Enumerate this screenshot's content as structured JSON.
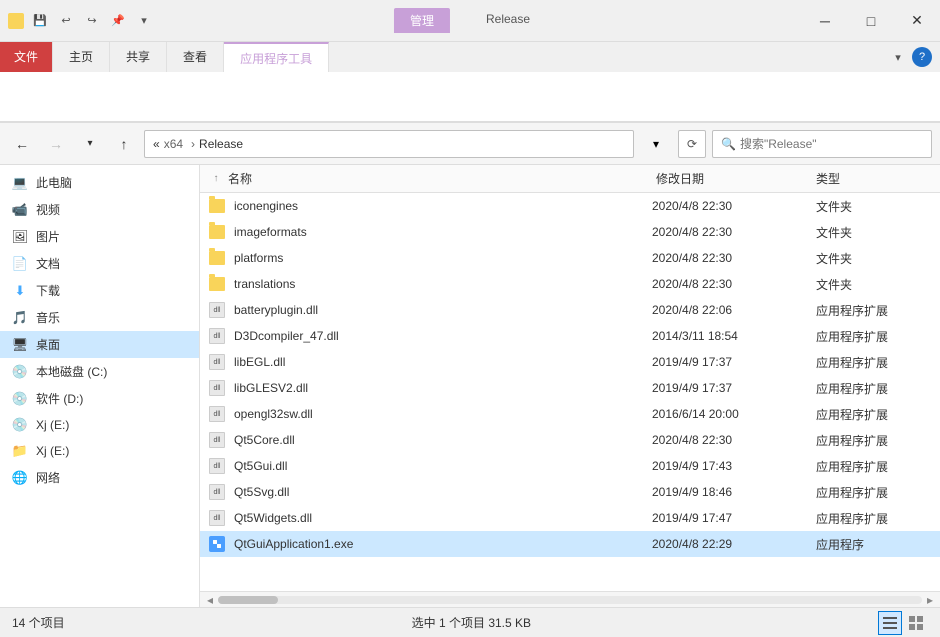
{
  "titleBar": {
    "appIcon": "folder",
    "tabManage": "管理",
    "tabName": "Release",
    "minimize": "─",
    "maximize": "□",
    "close": "✕"
  },
  "ribbon": {
    "tabs": [
      {
        "id": "file",
        "label": "文件",
        "active": false
      },
      {
        "id": "home",
        "label": "主页",
        "active": false
      },
      {
        "id": "share",
        "label": "共享",
        "active": false
      },
      {
        "id": "view",
        "label": "查看",
        "active": false
      },
      {
        "id": "apptools",
        "label": "应用程序工具",
        "active": true
      }
    ]
  },
  "addressBar": {
    "backDisabled": false,
    "forwardDisabled": true,
    "upLabel": "↑",
    "breadcrumb": [
      "«",
      "x64",
      "Release"
    ],
    "refreshLabel": "⟳",
    "searchPlaceholder": "搜索\"Release\""
  },
  "sidebar": {
    "items": [
      {
        "id": "this-pc",
        "label": "此电脑",
        "icon": "computer"
      },
      {
        "id": "video",
        "label": "视频",
        "icon": "folder-video"
      },
      {
        "id": "pictures",
        "label": "图片",
        "icon": "folder-pic"
      },
      {
        "id": "documents",
        "label": "文档",
        "icon": "folder-doc"
      },
      {
        "id": "downloads",
        "label": "下载",
        "icon": "download"
      },
      {
        "id": "music",
        "label": "音乐",
        "icon": "folder-music"
      },
      {
        "id": "desktop",
        "label": "桌面",
        "icon": "desktop",
        "selected": true
      },
      {
        "id": "local-c",
        "label": "本地磁盘 (C:)",
        "icon": "drive-c"
      },
      {
        "id": "drive-d",
        "label": "软件 (D:)",
        "icon": "drive-d"
      },
      {
        "id": "drive-xj-e",
        "label": "Xj (E:)",
        "icon": "drive-e"
      },
      {
        "id": "xj-e2",
        "label": "Xj (E:)",
        "icon": "drive-e2"
      },
      {
        "id": "network",
        "label": "网络",
        "icon": "network"
      }
    ]
  },
  "fileList": {
    "columns": {
      "name": "名称",
      "date": "修改日期",
      "type": "类型"
    },
    "files": [
      {
        "name": "iconengines",
        "date": "2020/4/8 22:30",
        "type": "文件夹",
        "kind": "folder"
      },
      {
        "name": "imageformats",
        "date": "2020/4/8 22:30",
        "type": "文件夹",
        "kind": "folder"
      },
      {
        "name": "platforms",
        "date": "2020/4/8 22:30",
        "type": "文件夹",
        "kind": "folder"
      },
      {
        "name": "translations",
        "date": "2020/4/8 22:30",
        "type": "文件夹",
        "kind": "folder"
      },
      {
        "name": "batteryplugin.dll",
        "date": "2020/4/8 22:06",
        "type": "应用程序扩展",
        "kind": "dll"
      },
      {
        "name": "D3Dcompiler_47.dll",
        "date": "2014/3/11 18:54",
        "type": "应用程序扩展",
        "kind": "dll"
      },
      {
        "name": "libEGL.dll",
        "date": "2019/4/9 17:37",
        "type": "应用程序扩展",
        "kind": "dll"
      },
      {
        "name": "libGLESV2.dll",
        "date": "2019/4/9 17:37",
        "type": "应用程序扩展",
        "kind": "dll"
      },
      {
        "name": "opengl32sw.dll",
        "date": "2016/6/14 20:00",
        "type": "应用程序扩展",
        "kind": "dll"
      },
      {
        "name": "Qt5Core.dll",
        "date": "2020/4/8 22:30",
        "type": "应用程序扩展",
        "kind": "dll"
      },
      {
        "name": "Qt5Gui.dll",
        "date": "2019/4/9 17:43",
        "type": "应用程序扩展",
        "kind": "dll"
      },
      {
        "name": "Qt5Svg.dll",
        "date": "2019/4/9 18:46",
        "type": "应用程序扩展",
        "kind": "dll"
      },
      {
        "name": "Qt5Widgets.dll",
        "date": "2019/4/9 17:47",
        "type": "应用程序扩展",
        "kind": "dll"
      },
      {
        "name": "QtGuiApplication1.exe",
        "date": "2020/4/8 22:29",
        "type": "应用程序",
        "kind": "exe",
        "selected": true
      }
    ]
  },
  "statusBar": {
    "total": "14 个项目",
    "selected": "选中 1 个项目  31.5 KB"
  }
}
